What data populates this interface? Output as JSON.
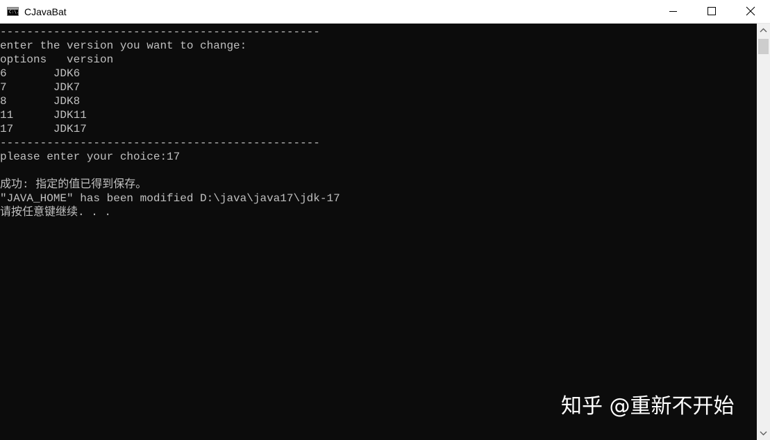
{
  "window": {
    "title": "CJavaBat",
    "app_icon_text": "C:\\.",
    "icon": "console-icon"
  },
  "controls": {
    "minimize_icon": "minimize-icon",
    "maximize_icon": "maximize-icon",
    "close_icon": "close-icon"
  },
  "console": {
    "lines": [
      "------------------------------------------------",
      "enter the version you want to change:",
      "options   version",
      "6       JDK6",
      "7       JDK7",
      "8       JDK8",
      "11      JDK11",
      "17      JDK17",
      "------------------------------------------------",
      "please enter your choice:17",
      "",
      "成功: 指定的值已得到保存。",
      "\"JAVA_HOME\" has been modified D:\\java\\java17\\jdk-17",
      "请按任意键继续. . ."
    ]
  },
  "watermark": {
    "text": "知乎 @重新不开始"
  },
  "colors": {
    "console_background": "#0c0c0c",
    "console_text": "#c0c0c0",
    "titlebar_background": "#ffffff"
  }
}
